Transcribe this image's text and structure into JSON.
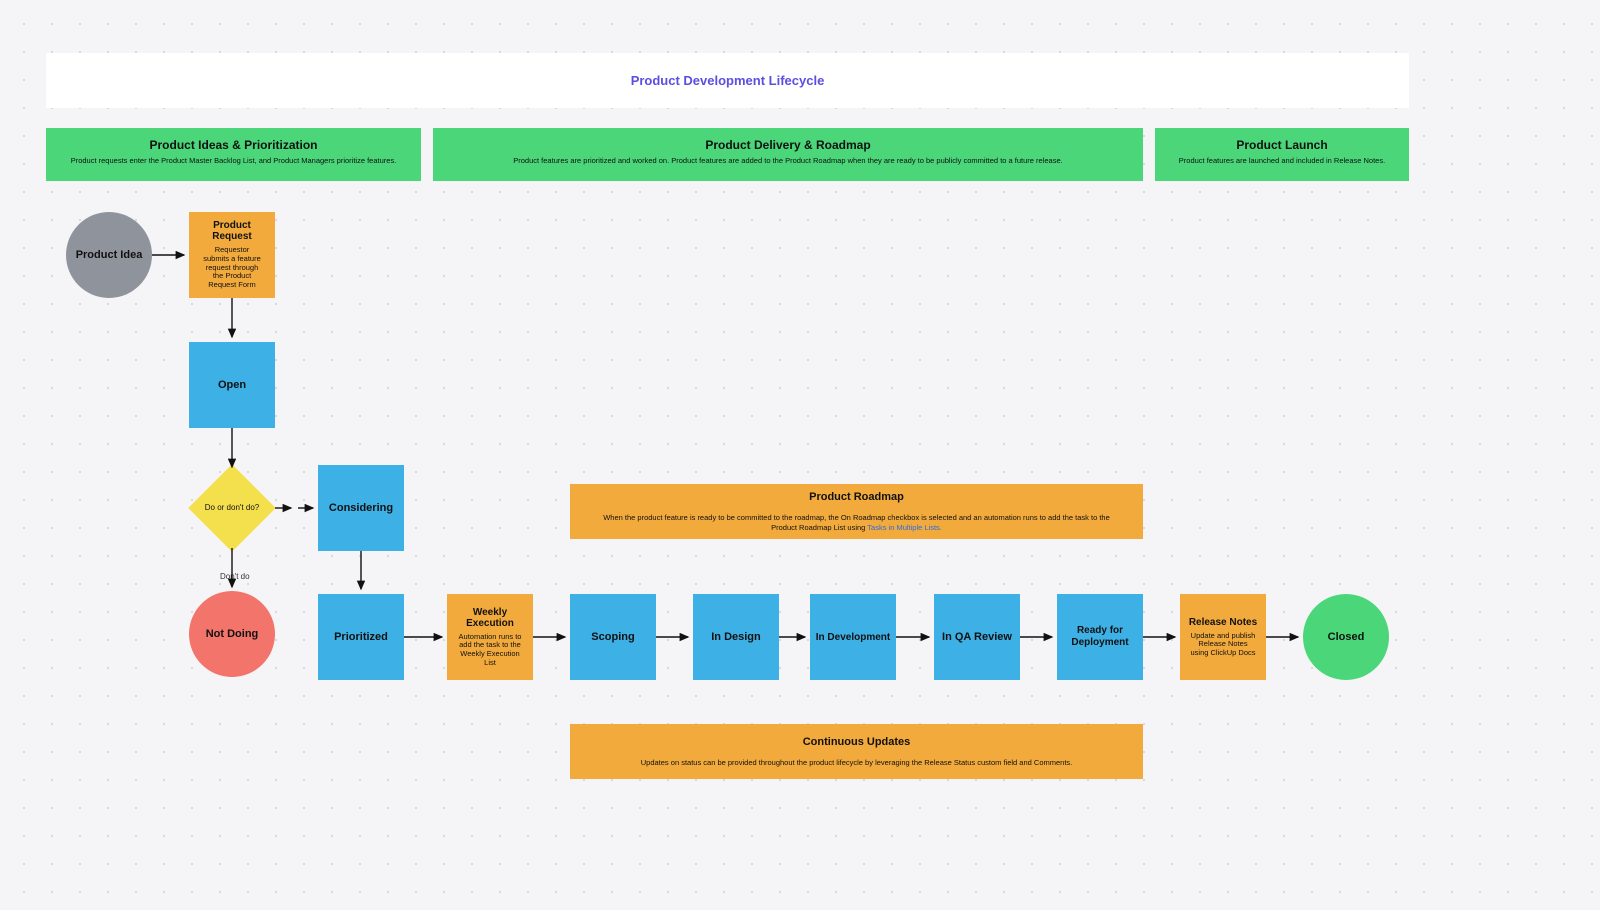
{
  "title": "Product Development Lifecycle",
  "stages": {
    "ideas": {
      "title": "Product Ideas & Prioritization",
      "sub": "Product requests enter the Product Master Backlog List, and Product Managers prioritize features."
    },
    "delivery": {
      "title": "Product Delivery & Roadmap",
      "sub": "Product features are prioritized and worked on. Product features are added to the Product Roadmap when they are ready to be publicly committed to a future release."
    },
    "launch": {
      "title": "Product Launch",
      "sub": "Product features are launched and included in Release Notes."
    }
  },
  "nodes": {
    "product_idea": {
      "label": "Product Idea"
    },
    "product_request": {
      "label": "Product Request",
      "sub": "Requestor submits a feature request through the Product Request Form"
    },
    "open": {
      "label": "Open"
    },
    "decision": {
      "label": "Do or don't do?"
    },
    "decision_no": "Don't do",
    "not_doing": {
      "label": "Not Doing"
    },
    "considering": {
      "label": "Considering"
    },
    "prioritized": {
      "label": "Prioritized"
    },
    "weekly_exec": {
      "label": "Weekly Execution",
      "sub": "Automation runs to add the task to the Weekly Execution List"
    },
    "scoping": {
      "label": "Scoping"
    },
    "in_design": {
      "label": "In Design"
    },
    "in_dev": {
      "label": "In Development"
    },
    "in_qa": {
      "label": "In QA Review"
    },
    "ready_deploy": {
      "label": "Ready for Deployment"
    },
    "release_notes": {
      "label": "Release Notes",
      "sub": "Update and publish Release Notes using ClickUp Docs"
    },
    "closed": {
      "label": "Closed"
    }
  },
  "banners": {
    "roadmap": {
      "title": "Product Roadmap",
      "sub": "When the product feature is ready to be committed to the roadmap, the On Roadmap checkbox is selected and an automation runs to add the task to the Product Roadmap List using ",
      "link": "Tasks in Multiple Lists."
    },
    "updates": {
      "title": "Continuous Updates",
      "sub": "Updates on status can be provided throughout the product lifecycle by leveraging the Release Status custom field and Comments."
    }
  }
}
